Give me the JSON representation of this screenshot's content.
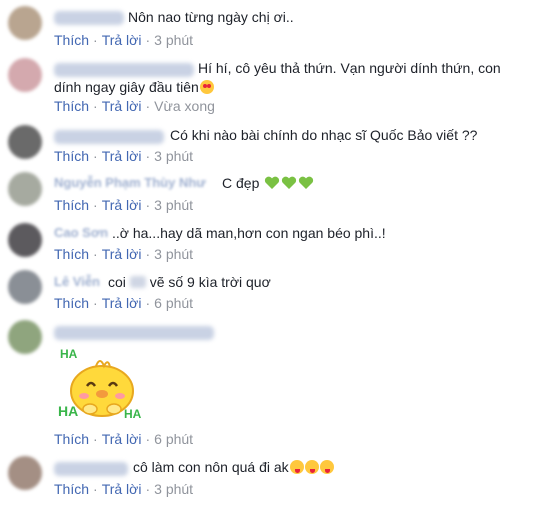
{
  "actions": {
    "like": "Thích",
    "reply": "Trả lời"
  },
  "comments": [
    {
      "text": "Nôn nao từng ngày chị ơi..",
      "time": "3 phút"
    },
    {
      "text_line1": "Hí hí, cô yêu thả thứn. Vạn người dính thứn, con",
      "text_line2": "dính ngay giây đầu tiên",
      "emoji": "heart-eyes-emoji",
      "time": "Vừa xong"
    },
    {
      "text": "Có khi nào bài chính do nhạc sĩ Quốc Bảo viết ??",
      "time": "3 phút"
    },
    {
      "name": "Nguyễn Phạm Thùy Như",
      "text": "C đẹp",
      "emoji": "green-heart-emoji",
      "time": "3 phút"
    },
    {
      "name": "Cao Sơn",
      "text": "..ờ ha...hay dã man,hơn con ngan béo phì..!",
      "time": "3 phút"
    },
    {
      "name": "Lê Viễn",
      "text_before": "coi",
      "text_after": "vẽ số 9 kìa trời quơ",
      "time": "6 phút"
    },
    {
      "sticker": "haha-chick-sticker",
      "sticker_text": [
        "HA",
        "HA",
        "HA"
      ],
      "time": "6 phút"
    },
    {
      "text": "cô làm con nôn quá đi ak",
      "emoji": "tongue-wink-emoji",
      "time": "3 phút"
    }
  ],
  "colors": {
    "link": "#4267b2",
    "meta": "#90949c",
    "text": "#1d2129"
  }
}
